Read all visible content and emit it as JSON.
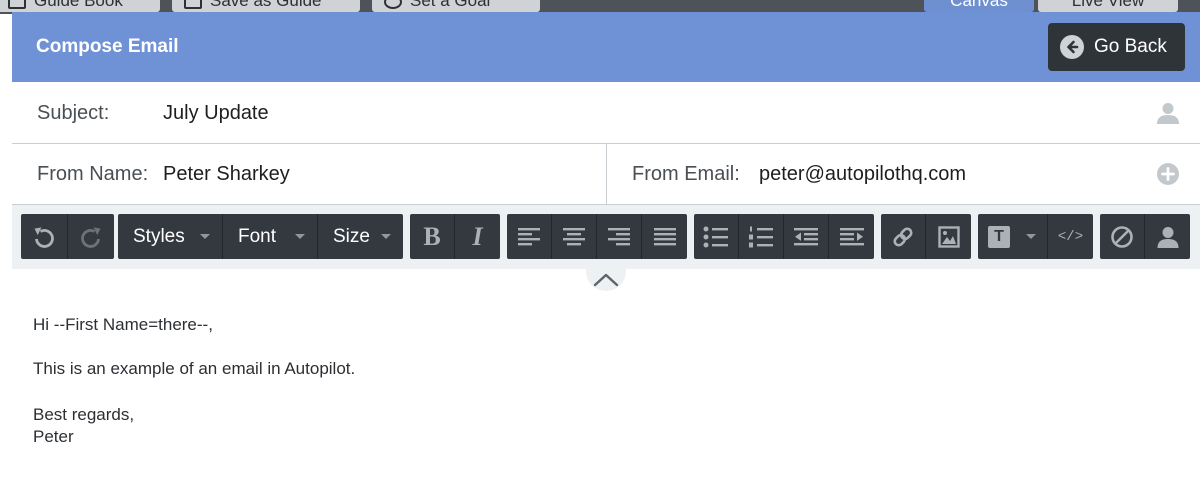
{
  "background_tabs": [
    {
      "label": "Guide Book"
    },
    {
      "label": "Save as Guide"
    },
    {
      "label": "Set a Goal"
    },
    {
      "label": "Canvas"
    },
    {
      "label": "Live View"
    }
  ],
  "header": {
    "title": "Compose Email",
    "go_back_label": "Go Back"
  },
  "subject": {
    "label": "Subject:",
    "value": "July Update"
  },
  "from": {
    "name_label": "From Name:",
    "name_value": "Peter Sharkey",
    "email_label": "From Email:",
    "email_value": "peter@autopilothq.com"
  },
  "toolbar": {
    "styles_label": "Styles",
    "font_label": "Font",
    "size_label": "Size",
    "bold_label": "B",
    "italic_label": "I",
    "code_label": "</>",
    "text_block_label": "T"
  },
  "editor": {
    "greeting": "Hi --First Name=there--,",
    "body": "This is an example of an email in Autopilot.",
    "closing": "Best regards,",
    "signature": "Peter"
  },
  "colors": {
    "header_bg": "#6f92d6",
    "toolbar_button": "#33393e",
    "go_back_bg": "#2f3439"
  }
}
